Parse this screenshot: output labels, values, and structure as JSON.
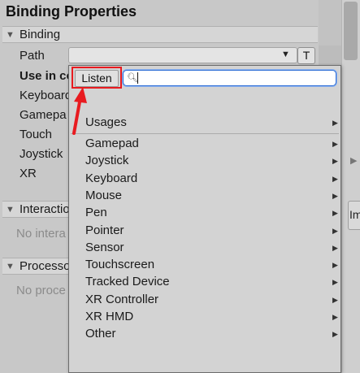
{
  "panel": {
    "title": "Binding Properties",
    "binding_section": {
      "label": "Binding",
      "path_label": "Path",
      "t_button": "T",
      "rows": [
        "Use in co",
        "Keyboard",
        "Gamepa",
        "Touch",
        "Joystick",
        "XR"
      ]
    },
    "interactions_section": {
      "label": "Interactio",
      "placeholder": "No intera"
    },
    "processors_section": {
      "label": "Processo",
      "placeholder": "No proce"
    },
    "side_tab_label": "Im"
  },
  "dropdown": {
    "listen_button": "Listen",
    "search_value": "",
    "usages_label": "Usages",
    "items": [
      "Gamepad",
      "Joystick",
      "Keyboard",
      "Mouse",
      "Pen",
      "Pointer",
      "Sensor",
      "Touchscreen",
      "Tracked Device",
      "XR Controller",
      "XR HMD",
      "Other"
    ]
  },
  "colors": {
    "highlight_red": "#e81b20",
    "focus_blue": "#2f6fd6"
  },
  "icons": {
    "submenu": "chevron-right-icon",
    "collapse": "triangle-down-icon",
    "search": "search-icon"
  }
}
